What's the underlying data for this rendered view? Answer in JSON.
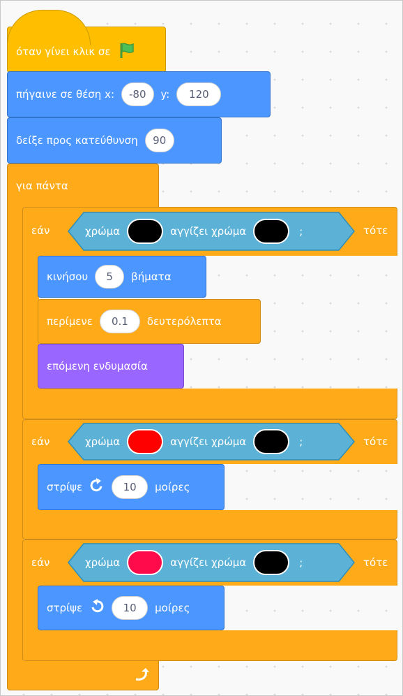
{
  "script": {
    "hat": {
      "label": "όταν γίνει κλικ σε",
      "icon": "green-flag-icon",
      "color": "#ffbf00"
    },
    "goto": {
      "label": "πήγαινε σε θέση x:",
      "x": "-80",
      "y_label": "y:",
      "y": "120",
      "color": "#4c97ff"
    },
    "point": {
      "label": "δείξε προς κατεύθυνση",
      "value": "90"
    },
    "forever": {
      "label": "για πάντα",
      "icon": "loop-arrow-icon",
      "color": "#ffab19"
    },
    "if1": {
      "if_label": "εάν",
      "then_label": "τότε",
      "cond": {
        "color_label": "χρώμα",
        "touching_label": "αγγίζει χρώμα",
        "semi": ";",
        "color1": "#000000",
        "color2": "#000000"
      },
      "move": {
        "label": "κινήσου",
        "value": "5",
        "suffix": "βήματα"
      },
      "wait": {
        "label": "περίμενε",
        "value": "0.1",
        "suffix": "δευτερόλεπτα"
      },
      "costume": {
        "label": "επόμενη ενδυμασία",
        "color": "#9966ff"
      }
    },
    "if2": {
      "if_label": "εάν",
      "then_label": "τότε",
      "cond": {
        "color_label": "χρώμα",
        "touching_label": "αγγίζει χρώμα",
        "semi": ";",
        "color1": "#ff0000",
        "color2": "#000000"
      },
      "turn": {
        "label": "στρίψε",
        "icon": "rotate-right-icon",
        "value": "10",
        "suffix": "μοίρες"
      }
    },
    "if3": {
      "if_label": "εάν",
      "then_label": "τότε",
      "cond": {
        "color_label": "χρώμα",
        "touching_label": "αγγίζει χρώμα",
        "semi": ";",
        "color1": "#ff0a4a",
        "color2": "#000000"
      },
      "turn": {
        "label": "στρίψε",
        "icon": "rotate-left-icon",
        "value": "10",
        "suffix": "μοίρες"
      }
    }
  }
}
